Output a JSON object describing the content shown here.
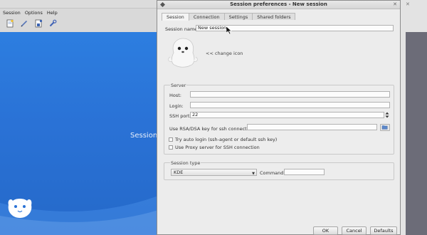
{
  "background_window": {
    "menu": [
      "Session",
      "Options",
      "Help"
    ],
    "toolbar_icons": [
      "new-session-icon",
      "edit-session-icon",
      "save-session-icon",
      "settings-icon"
    ],
    "center_label": "Session"
  },
  "dialog": {
    "title": "Session preferences - New session",
    "tabs": [
      "Session",
      "Connection",
      "Settings",
      "Shared folders"
    ],
    "session_name_label": "Session name:",
    "session_name_value": "New session",
    "change_icon_label": "<< change icon",
    "server": {
      "title": "Server",
      "host_label": "Host:",
      "host_value": "",
      "login_label": "Login:",
      "login_value": "",
      "ssh_port_label": "SSH port:",
      "ssh_port_value": "22",
      "rsa_label": "Use RSA/DSA key for ssh connection:",
      "rsa_value": "",
      "auto_login_label": "Try auto login (ssh-agent or default ssh key)",
      "proxy_label": "Use Proxy server for SSH connection"
    },
    "session_type": {
      "title": "Session type",
      "selected": "KDE",
      "command_label": "Command:",
      "command_value": ""
    },
    "buttons": {
      "ok": "OK",
      "cancel": "Cancel",
      "defaults": "Defaults"
    }
  },
  "colors": {
    "desktop_blue": "#2a72d6",
    "dialog_bg": "#ececec"
  }
}
